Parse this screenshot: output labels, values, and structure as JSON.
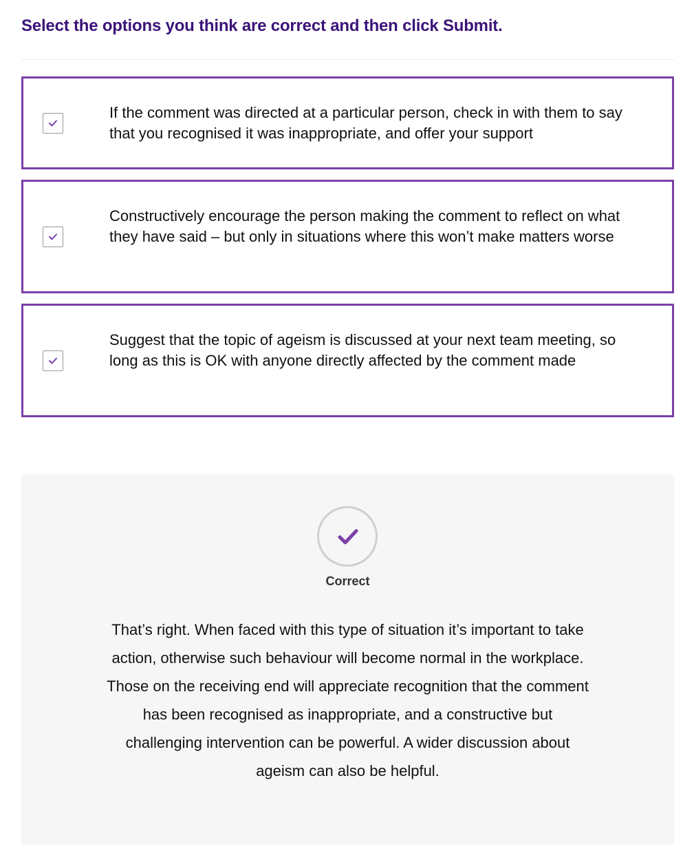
{
  "header": {
    "instruction": "Select the options you think are correct and then click Submit."
  },
  "options": [
    {
      "text": "If the comment was directed at a particular person, check in with them to say that you recognised it was inappropriate, and offer your support",
      "checked": true
    },
    {
      "text": "Constructively encourage the person making the comment to reflect on what they have said – but only in situations where this won’t make matters worse",
      "checked": true
    },
    {
      "text": "Suggest that the topic of ageism is discussed at your next team meeting, so long as this is OK with anyone directly affected by the comment made",
      "checked": true
    }
  ],
  "feedback": {
    "status_icon": "check-icon",
    "status_label": "Correct",
    "message": "That’s right. When faced with this type of situation it’s important to take action, otherwise such behaviour will become normal in the workplace. Those on the receiving end will appreciate recognition that the comment has been recognised as inappropriate, and a constructive but challenging intervention can be powerful. A wider discussion about ageism can also be helpful."
  },
  "colors": {
    "accent": "#7b3fa8",
    "heading": "#3a1378",
    "feedback_background": "#f6f6f6"
  }
}
